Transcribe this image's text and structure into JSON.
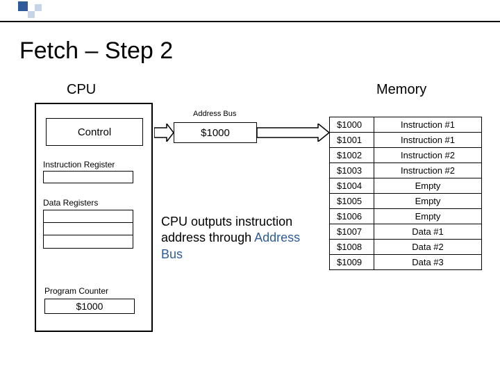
{
  "title": "Fetch – Step 2",
  "cpu": {
    "label": "CPU",
    "control": "Control",
    "instr_reg_label": "Instruction Register",
    "data_reg_label": "Data Registers",
    "pc_label": "Program Counter",
    "pc_value": "$1000"
  },
  "memory_label": "Memory",
  "address_bus": {
    "label": "Address Bus",
    "value": "$1000"
  },
  "caption_prefix": "CPU outputs instruction address through ",
  "caption_hl": "Address Bus",
  "memory": [
    {
      "addr": "$1000",
      "val": "Instruction #1"
    },
    {
      "addr": "$1001",
      "val": "Instruction #1"
    },
    {
      "addr": "$1002",
      "val": "Instruction #2"
    },
    {
      "addr": "$1003",
      "val": "Instruction #2"
    },
    {
      "addr": "$1004",
      "val": "Empty"
    },
    {
      "addr": "$1005",
      "val": "Empty"
    },
    {
      "addr": "$1006",
      "val": "Empty"
    },
    {
      "addr": "$1007",
      "val": "Data #1"
    },
    {
      "addr": "$1008",
      "val": "Data #2"
    },
    {
      "addr": "$1009",
      "val": "Data #3"
    }
  ]
}
